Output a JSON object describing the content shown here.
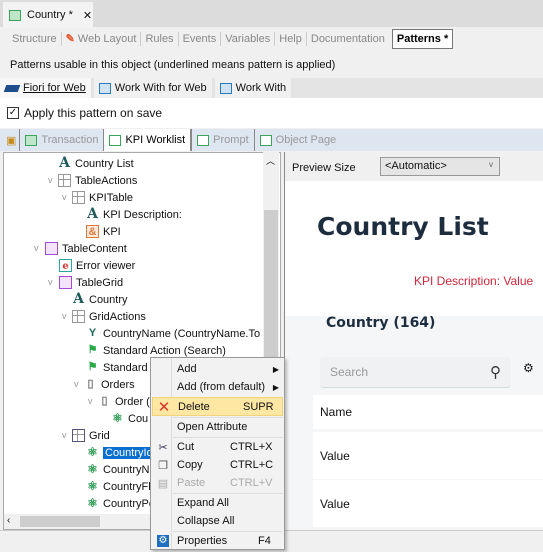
{
  "document_tab": {
    "title": "Country *",
    "close": "✕"
  },
  "designer_tabs": [
    "Structure",
    "Web Layout",
    "Rules",
    "Events",
    "Variables",
    "Help",
    "Documentation",
    "Patterns *"
  ],
  "patterns_info": "Patterns usable in this object (underlined means pattern is applied)",
  "pattern_tabs": [
    "Fiori for Web",
    "Work With for Web",
    "Work With"
  ],
  "apply_checkbox": {
    "label": "Apply this pattern on save",
    "checked": true
  },
  "instance_tabs": [
    "Transaction",
    "KPI Worklist",
    "Prompt",
    "Object Page"
  ],
  "tree": [
    {
      "label": "Country List",
      "icon": "text-icon"
    },
    {
      "label": "TableActions",
      "icon": "table-icon"
    },
    {
      "label": "KPITable",
      "icon": "table-icon"
    },
    {
      "label": "KPI Description:",
      "icon": "text-icon"
    },
    {
      "label": "KPI",
      "icon": "variable-icon"
    },
    {
      "label": "TableContent",
      "icon": "table-icon"
    },
    {
      "label": "Error viewer",
      "icon": "error-viewer-icon"
    },
    {
      "label": "TableGrid",
      "icon": "table-icon"
    },
    {
      "label": "Country",
      "icon": "text-icon"
    },
    {
      "label": "GridActions",
      "icon": "table-icon"
    },
    {
      "label": "CountryName (CountryName.To",
      "icon": "filter-icon"
    },
    {
      "label": "Standard Action (Search)",
      "icon": "flag-icon"
    },
    {
      "label": "Standard A",
      "icon": "flag-icon"
    },
    {
      "label": "Orders",
      "icon": "orders-icon"
    },
    {
      "label": "Order (",
      "icon": "order-icon"
    },
    {
      "label": "Cou",
      "icon": "attribute-icon"
    },
    {
      "label": "Grid",
      "icon": "grid-icon"
    },
    {
      "label": "CountryId",
      "icon": "attribute-icon",
      "selected": true
    },
    {
      "label": "CountryNa",
      "icon": "attribute-icon"
    },
    {
      "label": "CountryFla",
      "icon": "attribute-icon"
    },
    {
      "label": "CountryPo",
      "icon": "attribute-icon"
    }
  ],
  "preview": {
    "size_label": "Preview Size",
    "size_value": "<Automatic>",
    "title": "Country List",
    "kpi": "KPI Description: Value",
    "grid_title": "Country (164)",
    "search_placeholder": "Search",
    "rows": [
      "Name",
      "Value",
      "Value"
    ]
  },
  "context_menu": [
    {
      "label": "Add",
      "submenu": true
    },
    {
      "label": "Add (from default)",
      "submenu": true
    },
    {
      "label": "Delete",
      "shortcut": "SUPR",
      "icon": "delete-icon",
      "highlighted": true
    },
    {
      "label": "Open Attribute"
    },
    {
      "label": "Cut",
      "shortcut": "CTRL+X",
      "icon": "cut-icon"
    },
    {
      "label": "Copy",
      "shortcut": "CTRL+C",
      "icon": "copy-icon"
    },
    {
      "label": "Paste",
      "shortcut": "CTRL+V",
      "icon": "paste-icon",
      "disabled": true
    },
    {
      "label": "Expand All"
    },
    {
      "label": "Collapse All"
    },
    {
      "label": "Properties",
      "shortcut": "F4",
      "icon": "gear-icon"
    }
  ],
  "colors": {
    "selection": "#0b6fd0",
    "kpi": "#d2263a",
    "menu_highlight": "#fde7a3",
    "instance_tabs_bg": "#dde6f1"
  }
}
